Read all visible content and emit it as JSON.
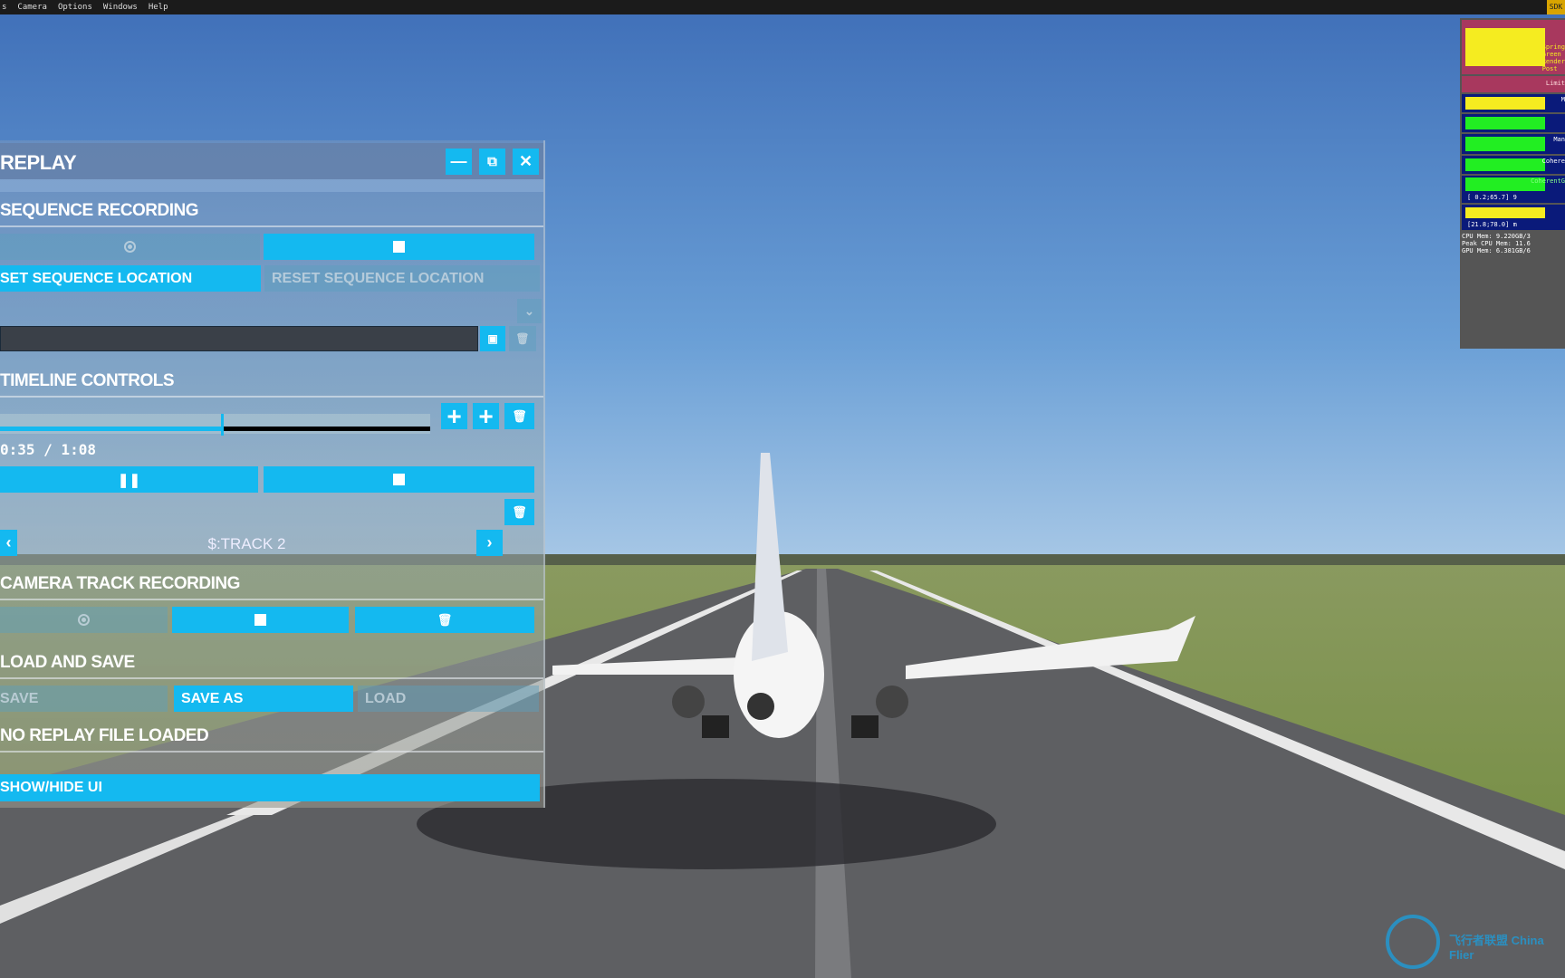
{
  "menu": {
    "items": [
      "s",
      "Camera",
      "Options",
      "Windows",
      "Help"
    ],
    "sdk_label": "SDK"
  },
  "replay": {
    "title": "REPLAY",
    "sequence_recording": {
      "header": "SEQUENCE RECORDING",
      "set_location": "SET SEQUENCE LOCATION",
      "reset_location": "RESET SEQUENCE LOCATION",
      "name_value": ""
    },
    "timeline": {
      "header": "TIMELINE CONTROLS",
      "time": "0:35 / 1:08",
      "progress": 0.515,
      "track": "$:TRACK 2"
    },
    "camera_track": {
      "header": "CAMERA TRACK RECORDING"
    },
    "load_save": {
      "header": "LOAD AND SAVE",
      "save": "SAVE",
      "save_as": "SAVE AS",
      "load": "LOAD"
    },
    "status": "NO REPLAY FILE LOADED",
    "show_hide": "SHOW/HIDE UI"
  },
  "perf": {
    "limit": "Limit",
    "range1": "[ 0.2;65.7] 9",
    "range2": "[21.8;78.0] m",
    "cpu_mem": "CPU Mem: 9.220GB/3",
    "peak_cpu": "Peak CPU Mem: 11.6",
    "gpu_mem": "GPU Mem: 6.381GB/6",
    "labels": [
      "Spring",
      "Green",
      "Render",
      "Post",
      "M",
      "Man",
      "Cohere",
      "CoherentG"
    ]
  },
  "colors": {
    "accent": "#14b9f0",
    "sky": "#4a7cc0",
    "perf_red": "#a8385e",
    "perf_blue": "#0a1a7a",
    "perf_yellow": "#f5ec20",
    "perf_green": "#22ee22"
  },
  "watermark": "飞行者联盟 China Flier"
}
